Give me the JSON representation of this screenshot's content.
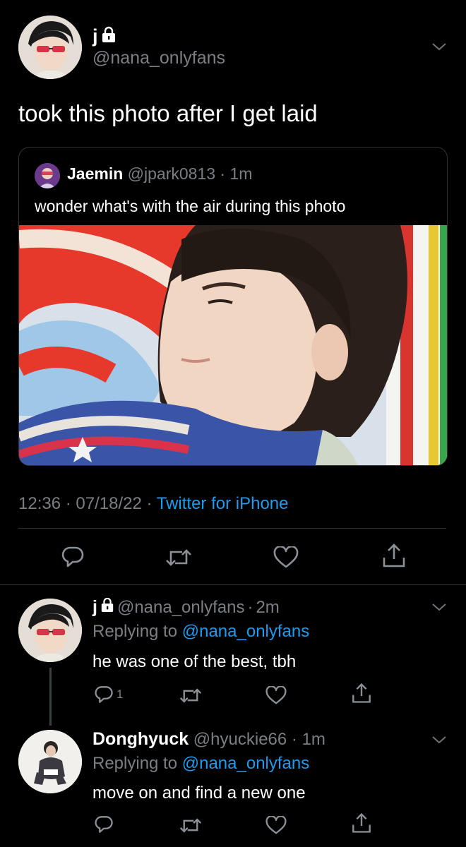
{
  "main_tweet": {
    "display_name": "j",
    "handle": "@nana_onlyfans",
    "text": "took this photo after I get laid",
    "quoted": {
      "name": "Jaemin",
      "handle": "@jpark0813",
      "time": "1m",
      "text": "wonder what's with the air during this photo"
    },
    "time": "12:36",
    "date": "07/18/22",
    "source": "Twitter for iPhone"
  },
  "replies": [
    {
      "display_name": "j",
      "handle": "@nana_onlyfans",
      "time": "2m",
      "replying_prefix": "Replying to",
      "replying_to": "@nana_onlyfans",
      "text": "he was one of the best, tbh",
      "reply_count": "1"
    },
    {
      "display_name": "Donghyuck",
      "handle": "@hyuckie66",
      "time": "1m",
      "replying_prefix": "Replying to",
      "replying_to": "@nana_onlyfans",
      "text": "move on and find a new one"
    }
  ],
  "colors": {
    "background": "#000000",
    "muted": "#7a7f84",
    "link": "#1d9bf0",
    "divider": "#2f3336"
  },
  "icons": [
    "lock-icon",
    "chevron-down-icon",
    "reply-icon",
    "retweet-icon",
    "like-icon",
    "share-icon"
  ]
}
